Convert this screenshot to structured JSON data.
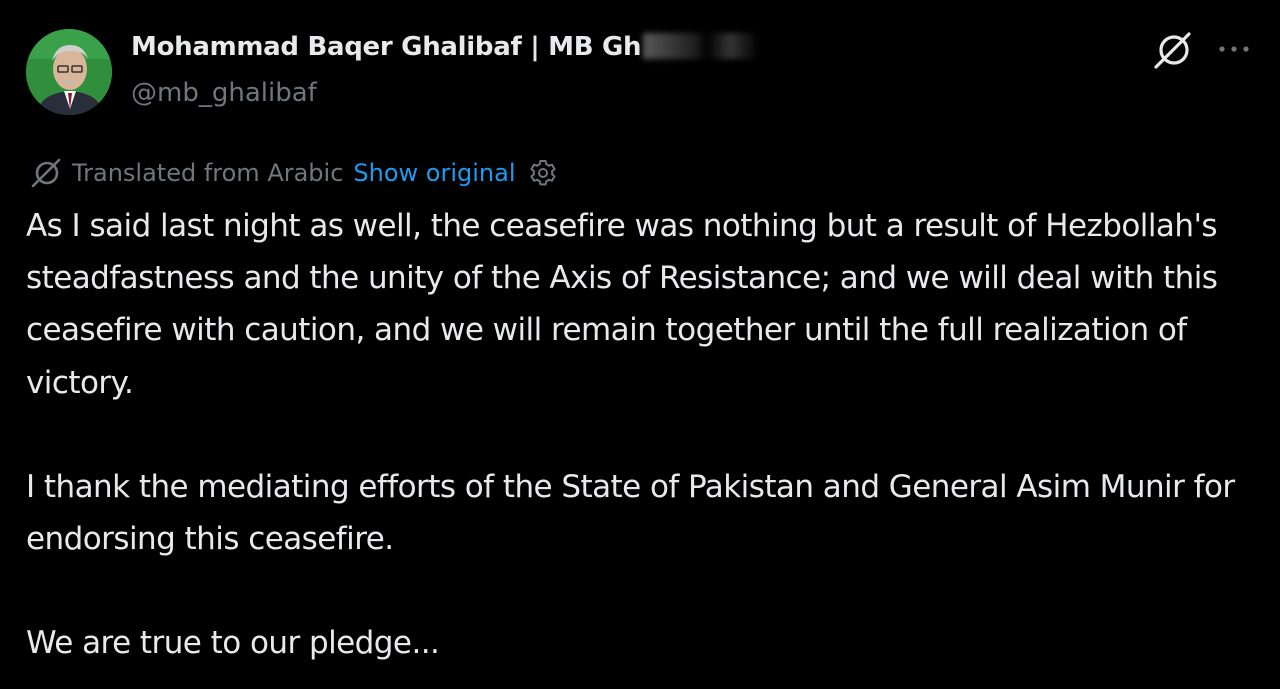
{
  "post": {
    "author": {
      "display_name": "Mohammad Baqer Ghalibaf | MB Gh",
      "handle": "@mb_ghalibaf"
    },
    "translation": {
      "label": "Translated from Arabic",
      "show_original_label": "Show original"
    },
    "paragraphs": [
      "As I said last night as well, the ceasefire was nothing but a result of Hezbollah's steadfastness and the unity of the Axis of Resistance; and we will deal with this ceasefire with caution, and we will remain together until the full realization of victory.",
      "I thank the mediating efforts of the State of Pakistan and General Asim Munir for endorsing this ceasefire.",
      "We are true to our pledge..."
    ],
    "icons": {
      "grok": "grok-icon",
      "more": "more-icon",
      "translate": "translate-icon",
      "settings": "settings-icon"
    }
  },
  "colors": {
    "background": "#000000",
    "primary_text": "#e7e9ea",
    "secondary_text": "#71767b",
    "link": "#1d9bf0",
    "avatar_bg": "#2e8b3a"
  }
}
